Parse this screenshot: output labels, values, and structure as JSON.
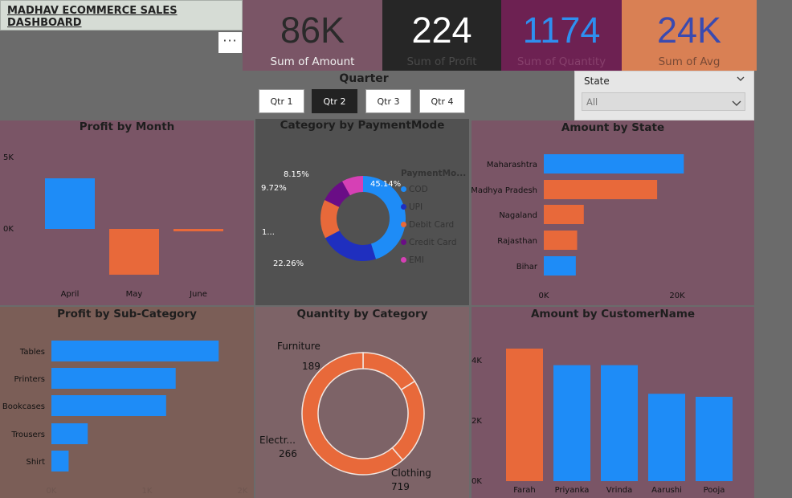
{
  "header": {
    "title": "MADHAV ECOMMERCE SALES DASHBOARD",
    "more_label": "···"
  },
  "kpis": [
    {
      "value": "86K",
      "label": "Sum of Amount",
      "bg": "#7a5566",
      "fg": "#2a2a2a",
      "lblcolor": "#f0f0f0"
    },
    {
      "value": "224",
      "label": "Sum of Profit",
      "bg": "#262626",
      "fg": "#ffffff",
      "lblcolor": "#4a4a4a"
    },
    {
      "value": "1174",
      "label": "Sum of Quantity",
      "bg": "#6d2152",
      "fg": "#2e8ff0",
      "lblcolor": "#87406c"
    },
    {
      "value": "24K",
      "label": "Sum of Avg",
      "bg": "#d98054",
      "fg": "#3a4ab0",
      "lblcolor": "#7a4a36"
    }
  ],
  "quarter_slicer": {
    "title": "Quarter",
    "options": [
      "Qtr 1",
      "Qtr 2",
      "Qtr 3",
      "Qtr 4"
    ],
    "selected": "Qtr 2"
  },
  "state_slicer": {
    "title": "State",
    "value": "All"
  },
  "profit_by_month": {
    "title": "Profit by Month",
    "ticks": [
      "5K",
      "0K"
    ],
    "categories": [
      "April",
      "May",
      "June"
    ]
  },
  "category_by_payment": {
    "title": "Category by PaymentMode",
    "legend_title": "PaymentMo...",
    "legend": [
      "COD",
      "UPI",
      "Debit Card",
      "Credit Card",
      "EMI"
    ],
    "labels": [
      "45.14%",
      "22.26%",
      "1...",
      "9.72%",
      "8.15%"
    ]
  },
  "amount_by_state": {
    "title": "Amount by State",
    "categories": [
      "Maharashtra",
      "Madhya Pradesh",
      "Nagaland",
      "Rajasthan",
      "Bihar"
    ],
    "ticks": [
      "0K",
      "20K"
    ]
  },
  "profit_by_subcategory": {
    "title": "Profit by Sub-Category",
    "categories": [
      "Tables",
      "Printers",
      "Bookcases",
      "Trousers",
      "Shirt"
    ],
    "ticks": [
      "0K",
      "1K",
      "2K"
    ]
  },
  "quantity_by_category": {
    "title": "Quantity by Category",
    "labels": [
      {
        "name": "Furniture",
        "value": "189"
      },
      {
        "name": "Electr...",
        "value": "266"
      },
      {
        "name": "Clothing",
        "value": "719"
      }
    ]
  },
  "amount_by_customer": {
    "title": "Amount by CustomerName",
    "categories": [
      "Farah",
      "Priyanka",
      "Vrinda",
      "Aarushi",
      "Pooja"
    ],
    "ticks": [
      "4K",
      "2K",
      "0K"
    ]
  },
  "colors": {
    "blue": "#1e8cf7",
    "orange": "#e8693a",
    "navy": "#1f2fbf",
    "purple": "#6a0d86",
    "pink": "#d640b5"
  },
  "chart_data": [
    {
      "type": "bar",
      "title": "Profit by Month",
      "categories": [
        "April",
        "May",
        "June"
      ],
      "values": [
        4200,
        -3800,
        -100
      ],
      "ylim": [
        -4000,
        5000
      ]
    },
    {
      "type": "pie",
      "title": "Category by PaymentMode",
      "categories": [
        "COD",
        "UPI",
        "Debit Card",
        "Credit Card",
        "EMI"
      ],
      "values": [
        45.14,
        22.26,
        14.73,
        9.72,
        8.15
      ]
    },
    {
      "type": "bar",
      "title": "Amount by State",
      "categories": [
        "Maharashtra",
        "Madhya Pradesh",
        "Nagaland",
        "Rajasthan",
        "Bihar"
      ],
      "values": [
        21000,
        17000,
        6000,
        5000,
        4800
      ],
      "xlim": [
        0,
        25000
      ]
    },
    {
      "type": "bar",
      "title": "Profit by Sub-Category",
      "categories": [
        "Tables",
        "Printers",
        "Bookcases",
        "Trousers",
        "Shirt"
      ],
      "values": [
        1750,
        1300,
        1200,
        380,
        180
      ],
      "xlim": [
        0,
        2000
      ]
    },
    {
      "type": "pie",
      "title": "Quantity by Category",
      "categories": [
        "Furniture",
        "Electronics",
        "Clothing"
      ],
      "values": [
        189,
        266,
        719
      ]
    },
    {
      "type": "bar",
      "title": "Amount by CustomerName",
      "categories": [
        "Farah",
        "Priyanka",
        "Vrinda",
        "Aarushi",
        "Pooja"
      ],
      "values": [
        4400,
        3850,
        3850,
        2900,
        2800
      ],
      "ylim": [
        0,
        4000
      ]
    }
  ]
}
